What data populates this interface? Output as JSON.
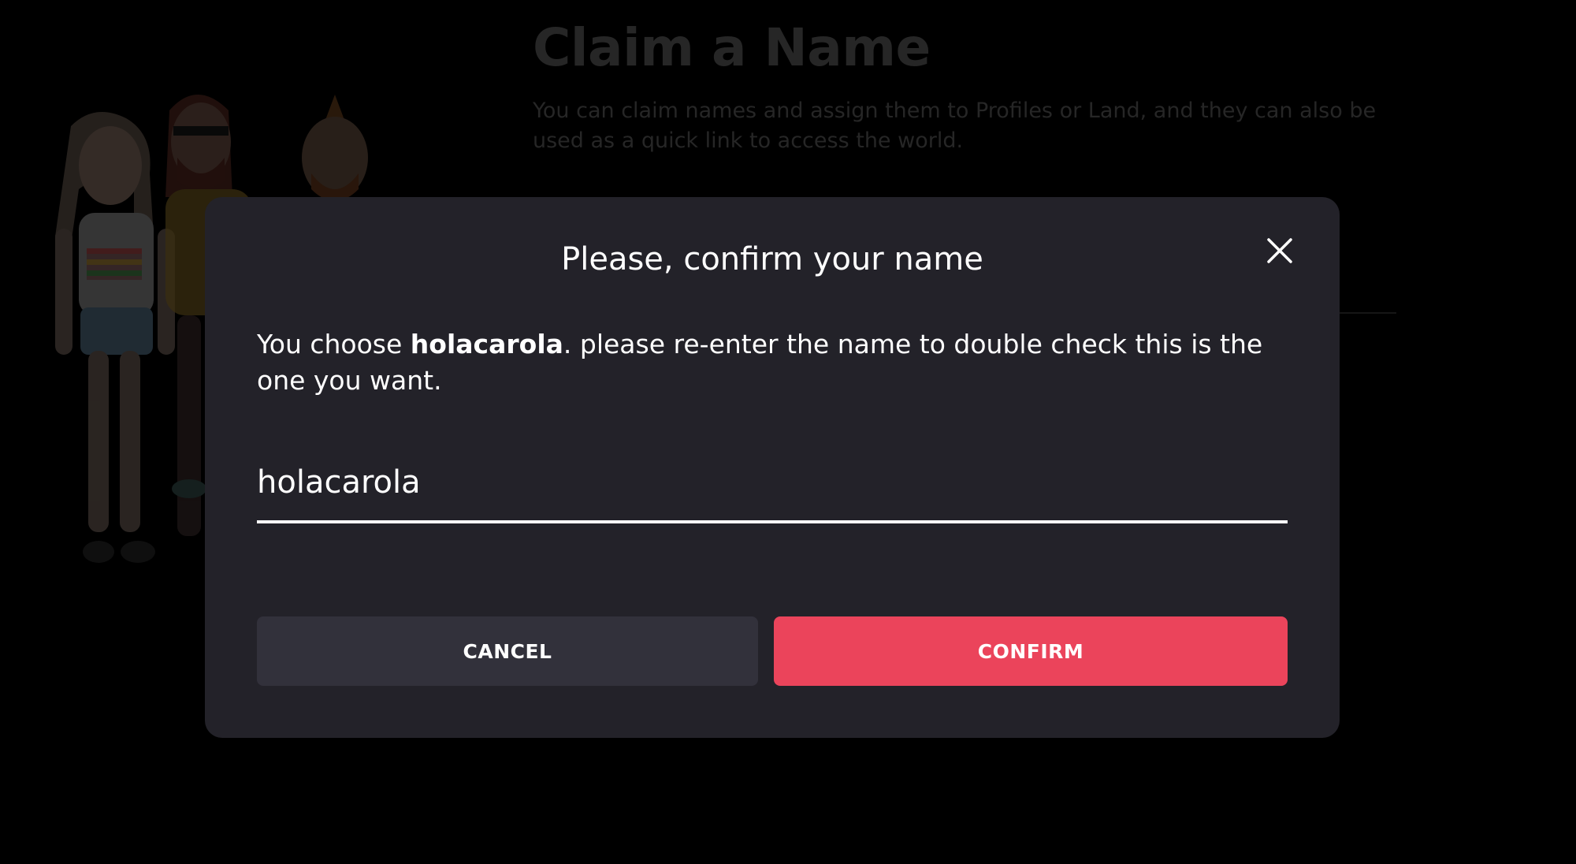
{
  "background": {
    "title": "Claim a Name",
    "subtitle": "You can claim names and assign them to Profiles or Land, and they can also be used as a quick link to access the world."
  },
  "modal": {
    "title": "Please, confirm your name",
    "message_prefix": "You choose ",
    "chosen_name": "holacarola",
    "message_suffix": ". please re-enter the name to double check this is the one you want.",
    "input_value": "holacarola",
    "cancel_label": "CANCEL",
    "confirm_label": "CONFIRM",
    "close_icon": "close-icon"
  },
  "colors": {
    "modal_bg": "#232229",
    "confirm": "#eb445b",
    "cancel": "#32313b"
  }
}
